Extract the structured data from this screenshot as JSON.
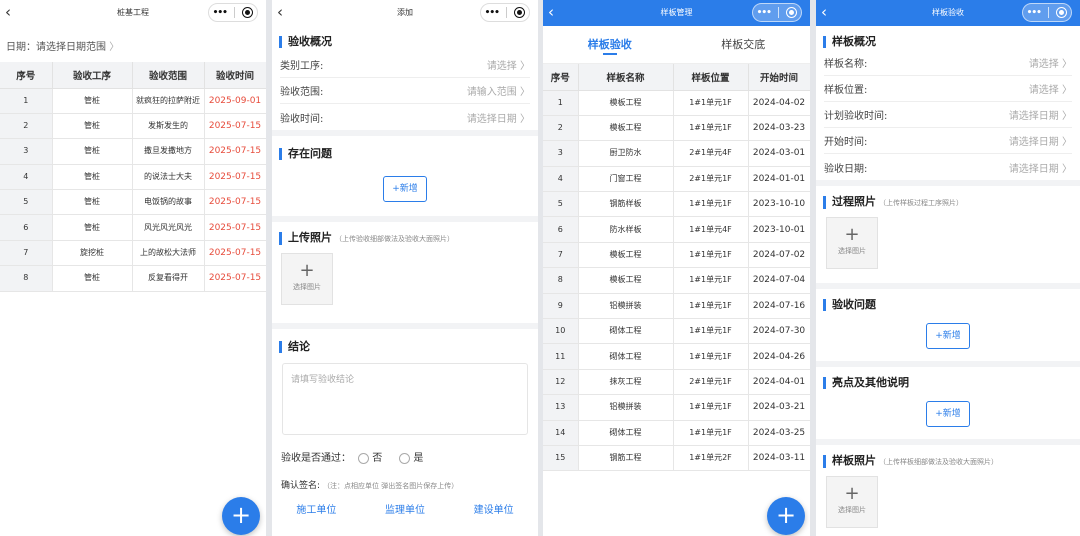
{
  "p1": {
    "title": "桩基工程",
    "date_label": "日期：",
    "date_placeholder": "请选择日期范围",
    "date_chevron": "〉",
    "cols": [
      "序号",
      "验收工序",
      "验收范围",
      "验收时间"
    ],
    "rows": [
      [
        "1",
        "管桩",
        "就疯狂的拉萨附近",
        "2025-09-01"
      ],
      [
        "2",
        "管桩",
        "发斯发生的",
        "2025-07-15"
      ],
      [
        "3",
        "管桩",
        "撒旦发撒地方",
        "2025-07-15"
      ],
      [
        "4",
        "管桩",
        "的说法士大夫",
        "2025-07-15"
      ],
      [
        "5",
        "管桩",
        "电饭锅的故事",
        "2025-07-15"
      ],
      [
        "6",
        "管桩",
        "风光风光风光",
        "2025-07-15"
      ],
      [
        "7",
        "旋挖桩",
        "上的故松大法师",
        "2025-07-15"
      ],
      [
        "8",
        "管桩",
        "反复看得开",
        "2025-07-15"
      ]
    ],
    "fab": "+"
  },
  "p2": {
    "title": "添加",
    "s1": "验收概况",
    "fields": [
      {
        "label": "类别工序:",
        "ph": "请选择"
      },
      {
        "label": "验收范围:",
        "ph": "请输入范围"
      },
      {
        "label": "验收时间:",
        "ph": "请选择日期"
      }
    ],
    "s2": "存在问题",
    "add": "+新增",
    "s3": "上传照片",
    "s3_note": "（上传验收细部做法及验收大面照片）",
    "upload_label": "选择图片",
    "upload_plus": "+",
    "s4": "结论",
    "conclusion_ph": "请填写验收结论",
    "pass_q": "验收是否通过：",
    "no": "否",
    "yes": "是",
    "sign_label": "确认签名:",
    "sign_note": "（注：点相应单位 弹出签名图片保存上传）",
    "units": [
      "施工单位",
      "监理单位",
      "建设单位"
    ]
  },
  "p3": {
    "title": "样板管理",
    "tabs": [
      "样板验收",
      "样板交底"
    ],
    "cols": [
      "序号",
      "样板名称",
      "样板位置",
      "开始时间"
    ],
    "rows": [
      [
        "1",
        "模板工程",
        "1#1单元1F",
        "2024-04-02"
      ],
      [
        "2",
        "模板工程",
        "1#1单元1F",
        "2024-03-23"
      ],
      [
        "3",
        "厨卫防水",
        "2#1单元4F",
        "2024-03-01"
      ],
      [
        "4",
        "门窗工程",
        "2#1单元1F",
        "2024-01-01"
      ],
      [
        "5",
        "钢筋样板",
        "1#1单元1F",
        "2023-10-10"
      ],
      [
        "6",
        "防水样板",
        "1#1单元4F",
        "2023-10-01"
      ],
      [
        "7",
        "模板工程",
        "1#1单元1F",
        "2024-07-02"
      ],
      [
        "8",
        "模板工程",
        "1#1单元1F",
        "2024-07-04"
      ],
      [
        "9",
        "铝模拼装",
        "1#1单元1F",
        "2024-07-16"
      ],
      [
        "10",
        "砌体工程",
        "1#1单元1F",
        "2024-07-30"
      ],
      [
        "11",
        "砌体工程",
        "1#1单元1F",
        "2024-04-26"
      ],
      [
        "12",
        "抹灰工程",
        "2#1单元1F",
        "2024-04-01"
      ],
      [
        "13",
        "铝模拼装",
        "1#1单元1F",
        "2024-03-21"
      ],
      [
        "14",
        "砌体工程",
        "1#1单元1F",
        "2024-03-25"
      ],
      [
        "15",
        "钢筋工程",
        "1#1单元2F",
        "2024-03-11"
      ]
    ],
    "fab": "+"
  },
  "p4": {
    "title": "样板验收",
    "s1": "样板概况",
    "fields": [
      {
        "label": "样板名称:",
        "ph": "请选择"
      },
      {
        "label": "样板位置:",
        "ph": "请选择"
      },
      {
        "label": "计划验收时间:",
        "ph": "请选择日期"
      },
      {
        "label": "开始时间:",
        "ph": "请选择日期"
      },
      {
        "label": "验收日期:",
        "ph": "请选择日期"
      }
    ],
    "s2": "过程照片",
    "s2_note": "（上传样板过程工序照片）",
    "upload_label": "选择图片",
    "upload_plus": "+",
    "s3": "验收问题",
    "add": "+新增",
    "s4": "亮点及其他说明",
    "s5": "样板照片",
    "s5_note": "（上传样板细部做法及验收大面照片）"
  },
  "nav": {
    "back": "‹",
    "dots": "•••"
  },
  "colors": {
    "accent": "#2b7de9",
    "date_red": "#e74c3c"
  }
}
